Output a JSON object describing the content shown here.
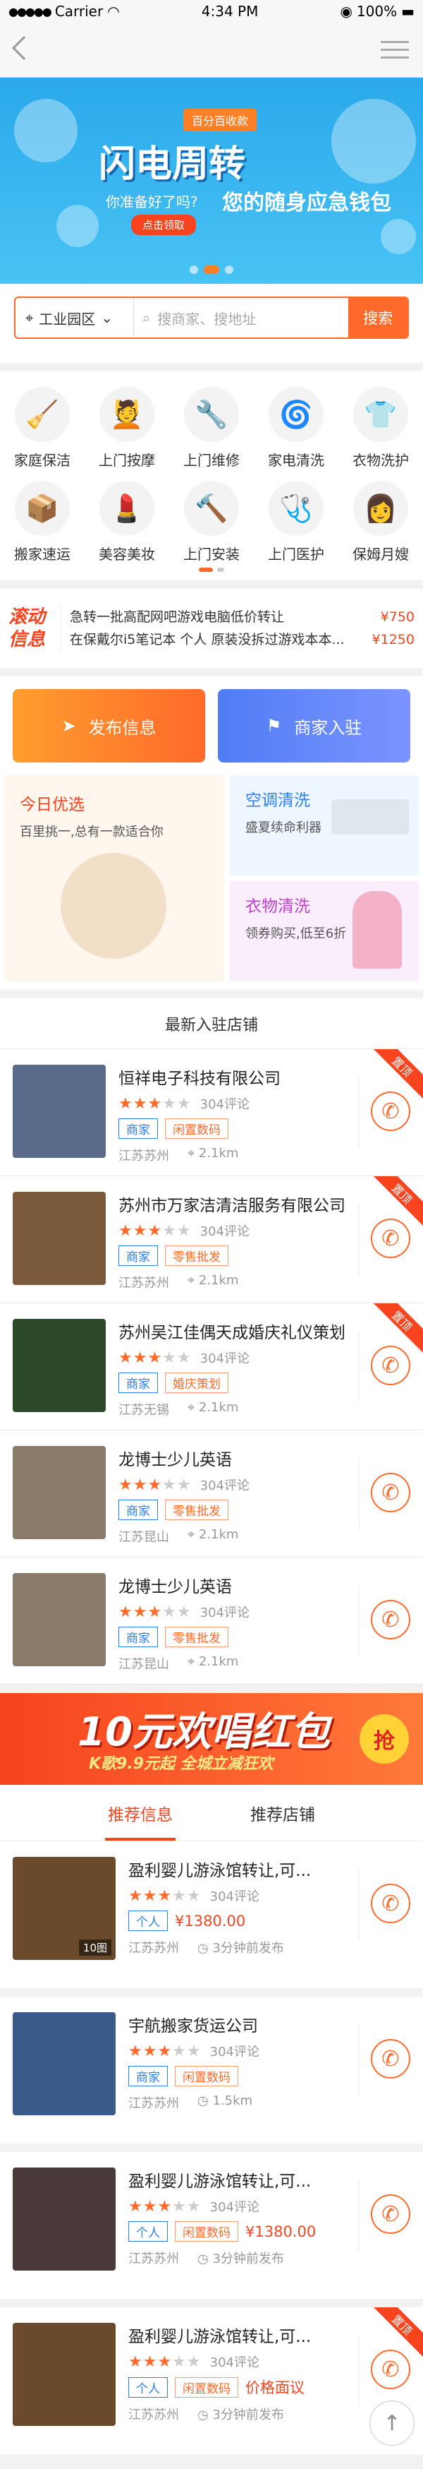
{
  "status": {
    "carrier": "Carrier",
    "time": "4:34 PM",
    "battery": "100%"
  },
  "banner": {
    "tag": "百分百收款",
    "title": "闪电周转",
    "sub": "你准备好了吗?",
    "sub2": "您的随身应急钱包",
    "btn": "点击领取"
  },
  "search": {
    "area": "工业园区",
    "placeholder": "搜商家、搜地址",
    "button": "搜索"
  },
  "categories": [
    {
      "label": "家庭保洁",
      "icon": "cleaning-icon",
      "glyph": "🧹"
    },
    {
      "label": "上门按摩",
      "icon": "massage-icon",
      "glyph": "💆"
    },
    {
      "label": "上门维修",
      "icon": "repair-icon",
      "glyph": "🔧"
    },
    {
      "label": "家电清洗",
      "icon": "washer-icon",
      "glyph": "🌀"
    },
    {
      "label": "衣物洗护",
      "icon": "clothes-icon",
      "glyph": "👕"
    },
    {
      "label": "搬家速运",
      "icon": "box-icon",
      "glyph": "📦"
    },
    {
      "label": "美容美妆",
      "icon": "lipstick-icon",
      "glyph": "💄"
    },
    {
      "label": "上门安装",
      "icon": "hammer-icon",
      "glyph": "🔨"
    },
    {
      "label": "上门医护",
      "icon": "medical-icon",
      "glyph": "🩺"
    },
    {
      "label": "保姆月嫂",
      "icon": "nanny-icon",
      "glyph": "👩"
    }
  ],
  "news": {
    "logo1": "滚动",
    "logo2": "信息",
    "items": [
      {
        "text": "急转一批高配网吧游戏电脑低价转让",
        "price": "¥750"
      },
      {
        "text": "在保戴尔i5笔记本 个人 原装没拆过游戏本本...",
        "price": "¥1250"
      }
    ]
  },
  "actions": {
    "publish": "发布信息",
    "merchant": "商家入驻"
  },
  "promos": {
    "today_title": "今日优选",
    "today_desc": "百里挑一,总有一款适合你",
    "ac_title": "空调清洗",
    "ac_desc": "盛夏续命利器",
    "cloth_title": "衣物清洗",
    "cloth_desc": "领券购买,低至6折"
  },
  "shops_title": "最新入驻店铺",
  "shops": [
    {
      "name": "恒祥电子科技有限公司",
      "reviews": "304评论",
      "tags": [
        "商家",
        "闲置数码"
      ],
      "loc": "江苏苏州",
      "dist": "2.1km",
      "top": true,
      "color": "#5a6b8a"
    },
    {
      "name": "苏州市万家洁清洁服务有限公司",
      "reviews": "304评论",
      "tags": [
        "商家",
        "零售批发"
      ],
      "loc": "江苏苏州",
      "dist": "2.1km",
      "top": true,
      "color": "#7a5a3a"
    },
    {
      "name": "苏州吴江佳偶天成婚庆礼仪策划",
      "reviews": "304评论",
      "tags": [
        "商家",
        "婚庆策划"
      ],
      "loc": "江苏无锡",
      "dist": "2.1km",
      "top": true,
      "color": "#2c4a2a"
    },
    {
      "name": "龙博士少儿英语",
      "reviews": "304评论",
      "tags": [
        "商家",
        "零售批发"
      ],
      "loc": "江苏昆山",
      "dist": "2.1km",
      "top": false,
      "color": "#8a7a6a"
    },
    {
      "name": "龙博士少儿英语",
      "reviews": "304评论",
      "tags": [
        "商家",
        "零售批发"
      ],
      "loc": "江苏昆山",
      "dist": "2.1km",
      "top": false,
      "color": "#8a7a6a"
    }
  ],
  "ad": {
    "title": "10元欢唱红包",
    "sub": "K歌9.9元起 全城立减狂欢",
    "btn": "抢"
  },
  "tabs": [
    "推荐信息",
    "推荐店铺"
  ],
  "items": [
    {
      "name": "盈利婴儿游泳馆转让,可...",
      "reviews": "304评论",
      "tags": [
        "个人"
      ],
      "price": "¥1380.00",
      "loc": "江苏苏州",
      "time": "3分钟前发布",
      "badge": "10图",
      "top": false,
      "color": "#6a4a2a"
    },
    {
      "name": "宇航搬家货运公司",
      "reviews": "304评论",
      "tags": [
        "商家",
        "闲置数码"
      ],
      "price": "",
      "loc": "江苏苏州",
      "time": "1.5km",
      "badge": "",
      "top": false,
      "color": "#3a5a8a"
    },
    {
      "name": "盈利婴儿游泳馆转让,可...",
      "reviews": "304评论",
      "tags": [
        "个人",
        "闲置数码"
      ],
      "price": "¥1380.00",
      "loc": "江苏苏州",
      "time": "3分钟前发布",
      "badge": "",
      "top": false,
      "color": "#4a3a3a"
    },
    {
      "name": "盈利婴儿游泳馆转让,可...",
      "reviews": "304评论",
      "tags": [
        "个人",
        "闲置数码"
      ],
      "price": "价格面议",
      "loc": "江苏苏州",
      "time": "3分钟前发布",
      "badge": "",
      "top": true,
      "color": "#6a4a2a"
    }
  ],
  "top_label": "置顶"
}
